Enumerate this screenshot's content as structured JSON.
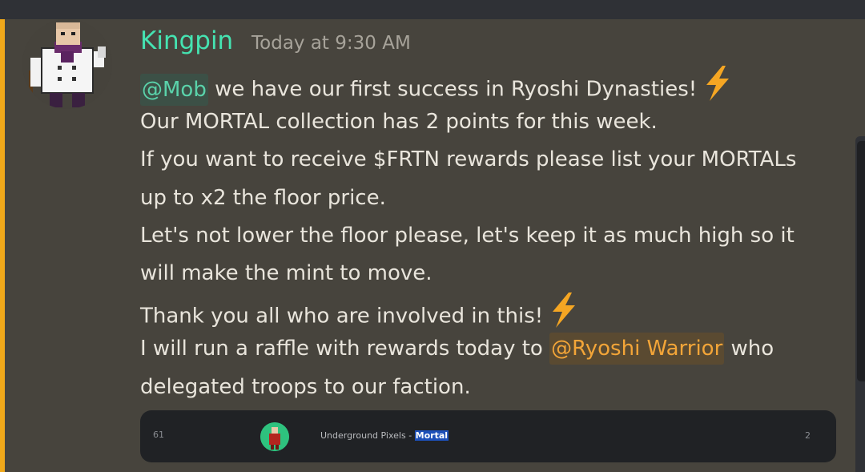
{
  "message": {
    "author": "Kingpin",
    "timestamp": "Today at 9:30 AM",
    "lines": {
      "l1_mention": "@Mob",
      "l1_text": " we have our first success in Ryoshi Dynasties!",
      "l2": "Our MORTAL collection has 2 points for this week.",
      "l3": "If you want to receive $FRTN rewards please list your MORTALs",
      "l4": "up to x2 the floor price.",
      "l5": "Let's not lower the floor please, let's keep it as much high so it",
      "l6": "will make the mint to move.",
      "l7": "Thank you all who are involved in this!",
      "l8_pre": "I will run a raffle with rewards today to ",
      "l8_mention": "@Ryoshi Warrior",
      "l8_post": " who",
      "l9": "delegated troops to our faction."
    }
  },
  "embed": {
    "left_number": "61",
    "title_prefix": "Underground Pixels - ",
    "title_highlight": "Mortal",
    "right_number": "2"
  },
  "colors": {
    "background": "#47443d",
    "accent_bar": "#f0a81a",
    "username": "#45e3b1",
    "mention_mob": "#5ad2aa",
    "mention_warrior": "#f3a538",
    "bolt": "#f5a623"
  },
  "icons": {
    "emoji": "lightning-bolt-emoji",
    "avatar": "pixel-kingpin-avatar"
  }
}
